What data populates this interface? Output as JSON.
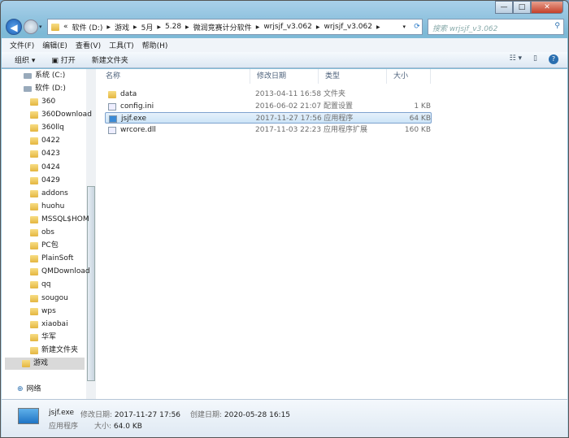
{
  "address": {
    "prefix": "«",
    "crumbs": [
      "软件 (D:)",
      "游戏",
      "5月",
      "5.28",
      "微润竞赛计分软件",
      "wrjsjf_v3.062",
      "wrjsjf_v3.062"
    ]
  },
  "search": {
    "placeholder": "搜索 wrjsjf_v3.062"
  },
  "menu": [
    "文件(F)",
    "编辑(E)",
    "查看(V)",
    "工具(T)",
    "帮助(H)"
  ],
  "toolbar": {
    "organize": "组织 ▾",
    "open": "打开",
    "new_folder": "新建文件夹"
  },
  "sidebar": {
    "drives": [
      "系统 (C:)",
      "软件 (D:)"
    ],
    "folders": [
      "360",
      "360Download",
      "360llq",
      "0422",
      "0423",
      "0424",
      "0429",
      "addons",
      "huohu",
      "MSSQL$HOM",
      "obs",
      "PC包",
      "PlainSoft",
      "QMDownload",
      "qq",
      "sougou",
      "wps",
      "xiaobai",
      "华军",
      "新建文件夹",
      "游戏"
    ],
    "selected": "游戏",
    "network": "网络"
  },
  "columns": [
    "名称",
    "修改日期",
    "类型",
    "大小"
  ],
  "files": [
    {
      "name": "data",
      "date": "2013-04-11 16:58",
      "type": "文件夹",
      "size": "",
      "icon": "folder-icon"
    },
    {
      "name": "config.ini",
      "date": "2016-06-02 21:07",
      "type": "配置设置",
      "size": "1 KB",
      "icon": "ini-icon"
    },
    {
      "name": "jsjf.exe",
      "date": "2017-11-27 17:56",
      "type": "应用程序",
      "size": "64 KB",
      "icon": "exe-icon",
      "selected": true
    },
    {
      "name": "wrcore.dll",
      "date": "2017-11-03 22:23",
      "type": "应用程序扩展",
      "size": "160 KB",
      "icon": "dll-icon"
    }
  ],
  "details": {
    "name": "jsjf.exe",
    "type": "应用程序",
    "modified_label": "修改日期:",
    "modified": "2017-11-27 17:56",
    "created_label": "创建日期:",
    "created": "2020-05-28 16:15",
    "size_label": "大小:",
    "size": "64.0 KB"
  }
}
